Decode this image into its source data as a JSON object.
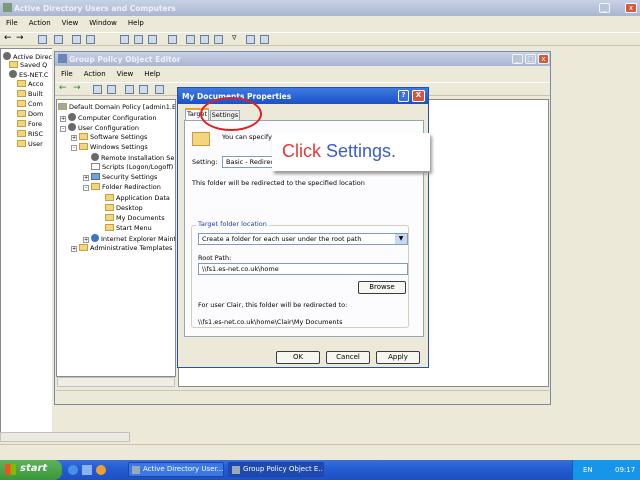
{
  "aduc": {
    "title": "Active Directory Users and Computers",
    "menu": [
      "File",
      "Action",
      "View",
      "Window",
      "Help"
    ],
    "tree": [
      "Active Direct",
      "Saved Q",
      "ES-NET.C",
      "Acco",
      "Built",
      "Com",
      "Dom",
      "Fore",
      "RISC",
      "User"
    ]
  },
  "gpo": {
    "title": "Group Policy Object Editor",
    "menu": [
      "File",
      "Action",
      "View",
      "Help"
    ],
    "tree": [
      "Default Domain Policy [admin1.ES-N",
      "Computer Configuration",
      "User Configuration",
      "Software Settings",
      "Windows Settings",
      "Remote Installation Ser",
      "Scripts (Logon/Logoff)",
      "Security Settings",
      "Folder Redirection",
      "Application Data",
      "Desktop",
      "My Documents",
      "Start Menu",
      "Internet Explorer Maint",
      "Administrative Templates"
    ]
  },
  "dialog": {
    "title": "My Documents Properties",
    "tabs": [
      "Target",
      "Settings"
    ],
    "intro": "You can specify the location of the My Documents folder.",
    "setting_label": "Setting:",
    "setting_value": "Basic - Redirect everyone's folder to the same location",
    "redirect_note": "This folder will be redirected to the specified location",
    "group_title": "Target folder location",
    "location_option": "Create a folder for each user under the root path",
    "root_path_label": "Root Path:",
    "root_path_value": "\\\\fs1.es-net.co.uk\\home",
    "browse_label": "Browse",
    "example_label": "For user Clair, this folder will be redirected to:",
    "example_path": "\\\\fs1.es-net.co.uk\\home\\Clair\\My Documents",
    "ok": "OK",
    "cancel": "Cancel",
    "apply": "Apply"
  },
  "callout": {
    "prefix": "Click",
    "target": "Settings.",
    "prefix_color": "#e03a3a",
    "target_color": "#3a5ccc"
  },
  "taskbar": {
    "start": "start",
    "tasks": [
      "Active Directory User...",
      "Group Policy Object E..."
    ],
    "lang": "EN",
    "clock": "09:17"
  }
}
